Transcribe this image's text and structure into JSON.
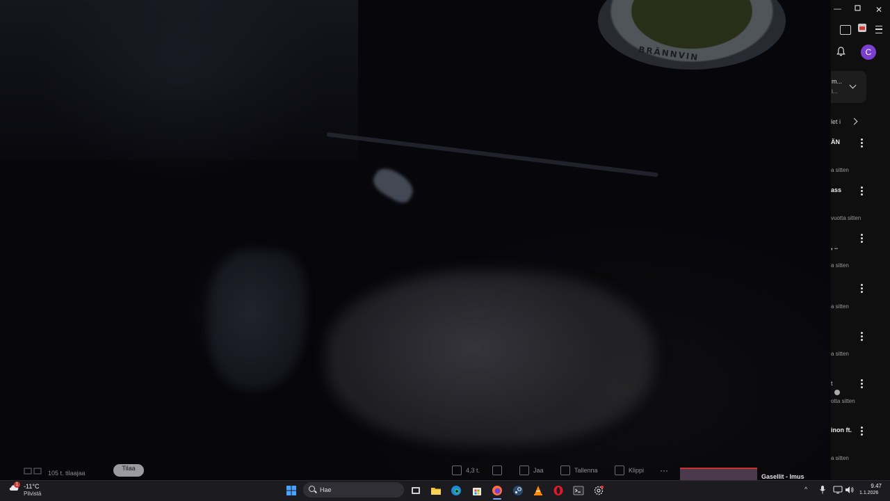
{
  "player": {
    "subscriber_count": "105 t. tilaajaa",
    "join_label": "Tilaa",
    "actions": {
      "likes": "4,3 t.",
      "share": "Jaa",
      "save": "Tallenna",
      "clip": "Klippi"
    },
    "scene_text": "BRÄNNVIN",
    "up_next_title": "Gasellit - Imus"
  },
  "sidebar": {
    "card_line1": "m...",
    "card_line2": "i...",
    "chip_text": "let i",
    "recommendations": [
      {
        "title": "ÄN",
        "meta": "a sitten"
      },
      {
        "title": "ass",
        "meta": "vuotta sitten"
      },
      {
        "title": ", ..",
        "meta": "a sitten"
      },
      {
        "title": "",
        "meta": "a sitten"
      },
      {
        "title": "",
        "meta": "a sitten"
      },
      {
        "title": "t",
        "meta": "otta sitten"
      },
      {
        "title": "inon ft.",
        "meta": "a sitten"
      }
    ],
    "avatar_letter": "C"
  },
  "taskbar": {
    "temperature": "-11°C",
    "condition": "Pilvistä",
    "weather_badge": "1",
    "search_placeholder": "Hae",
    "time": "9.47",
    "date": "1.1.2026"
  },
  "colors": {
    "accent": "#7b3fd0",
    "progress": "#d03030",
    "taskbar": "#1c1c20"
  }
}
